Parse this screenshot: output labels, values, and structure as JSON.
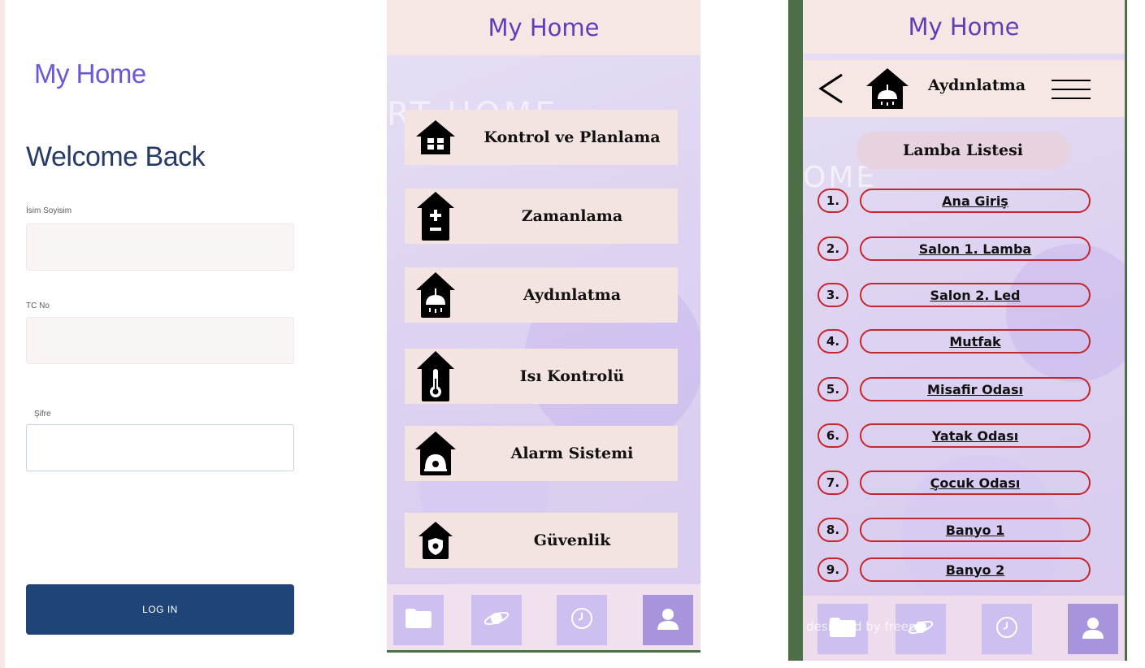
{
  "login": {
    "brand": "My Home",
    "welcome": "Welcome Back",
    "fields": [
      {
        "label": "İsim Soyisim",
        "value": ""
      },
      {
        "label": "TC No",
        "value": ""
      },
      {
        "label": "Şifre",
        "value": ""
      }
    ],
    "login_button": "LOG IN"
  },
  "menu": {
    "title": "My Home",
    "ghost_text": "RT HOME",
    "items": [
      {
        "label": "Kontrol ve Planlama",
        "icon": "grid-house-icon"
      },
      {
        "label": "Zamanlama",
        "icon": "timer-house-icon"
      },
      {
        "label": "Aydınlatma",
        "icon": "lamp-house-icon"
      },
      {
        "label": "Isı Kontrolü",
        "icon": "thermometer-house-icon"
      },
      {
        "label": "Alarm Sistemi",
        "icon": "alarm-house-icon"
      },
      {
        "label": "Güvenlik",
        "icon": "shield-house-icon"
      }
    ],
    "bottom_nav": [
      "folder-icon",
      "planet-icon",
      "clock-icon",
      "user-icon"
    ]
  },
  "lights": {
    "title": "My Home",
    "subtitle": "Aydınlatma",
    "list_title": "Lamba Listesi",
    "ghost_text": "OME",
    "lamps": [
      {
        "num": "1.",
        "name": "Ana Giriş"
      },
      {
        "num": "2.",
        "name": "Salon 1. Lamba"
      },
      {
        "num": "3.",
        "name": "Salon 2. Led"
      },
      {
        "num": "4.",
        "name": "Mutfak"
      },
      {
        "num": "5.",
        "name": "Misafir Odası"
      },
      {
        "num": "6.",
        "name": "Yatak Odası"
      },
      {
        "num": "7.",
        "name": "Çocuk Odası"
      },
      {
        "num": "8.",
        "name": "Banyo 1"
      },
      {
        "num": "9.",
        "name": "Banyo 2"
      }
    ],
    "watermark": "designed by freepik"
  },
  "colors": {
    "brand_purple": "#6e57d6",
    "login_button": "#1f4478",
    "lamp_border": "#c6262e",
    "frame_green": "#4d6e47"
  }
}
